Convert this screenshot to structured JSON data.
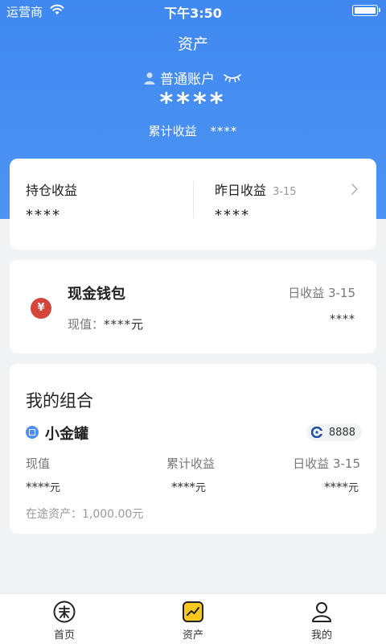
{
  "status_bar": {
    "carrier": "运营商",
    "time": "下午3:50"
  },
  "header": {
    "title": "资产",
    "account_label": "普通账户",
    "total_masked": "****",
    "cumulative_label": "累计收益",
    "cumulative_masked": "****"
  },
  "summary": {
    "holding_label": "持仓收益",
    "holding_value": "****",
    "yesterday_label": "昨日收益",
    "yesterday_date": "3-15",
    "yesterday_value": "****"
  },
  "wallet": {
    "icon_glyph": "¥",
    "title": "现金钱包",
    "current_value_label": "现值：",
    "current_value": "****元",
    "daily_label": "日收益 3-15",
    "daily_value": "****"
  },
  "combo": {
    "title": "我的组合",
    "product_name": "小金罐",
    "bank_code": "8888",
    "cols": [
      {
        "label": "现值",
        "value": "****",
        "unit": "元"
      },
      {
        "label": "累计收益",
        "value": "****",
        "unit": "元"
      },
      {
        "label": "日收益 3-15",
        "value": "****",
        "unit": "元"
      }
    ],
    "in_transit": "在途资产：1,000.00元"
  },
  "tabbar": {
    "items": [
      {
        "label": "首页",
        "icon": "home-logo-icon"
      },
      {
        "label": "资产",
        "icon": "assets-chart-icon",
        "active": true
      },
      {
        "label": "我的",
        "icon": "person-icon"
      }
    ]
  },
  "colors": {
    "primary": "#3f88f0",
    "accent_yellow": "#f7c81e",
    "wallet_red": "#d6453c",
    "bank_blue": "#1f4fa3"
  }
}
